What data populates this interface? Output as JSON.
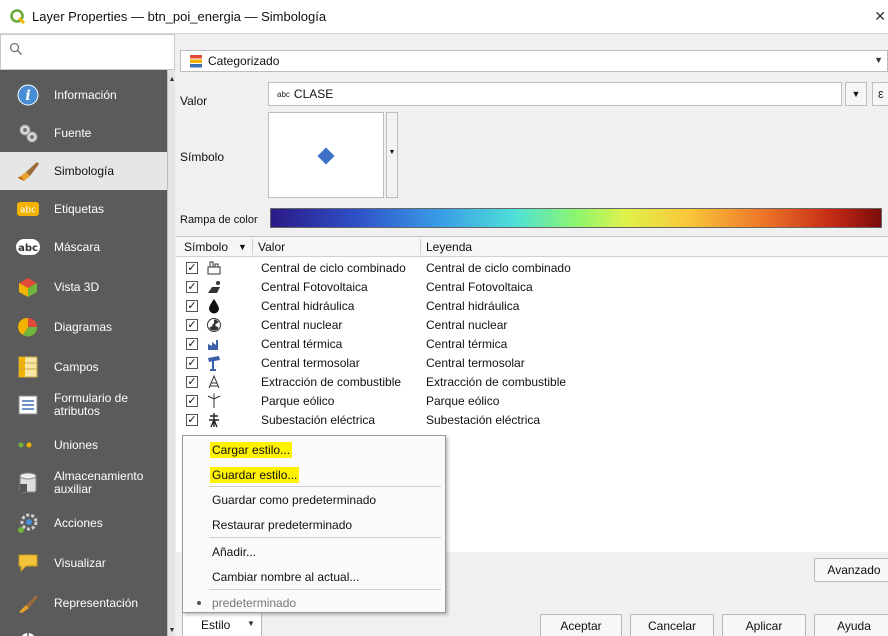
{
  "window": {
    "title": "Layer Properties — btn_poi_energia — Simbología"
  },
  "search": {
    "placeholder": ""
  },
  "sidebar": {
    "items": [
      {
        "label": "Información",
        "label2": "",
        "icon": "info-icon",
        "active": false
      },
      {
        "label": "Fuente",
        "label2": "",
        "icon": "source-icon",
        "active": false
      },
      {
        "label": "Simbología",
        "label2": "",
        "icon": "symbology-icon",
        "active": true
      },
      {
        "label": "Etiquetas",
        "label2": "",
        "icon": "labels-icon",
        "active": false
      },
      {
        "label": "Máscara",
        "label2": "",
        "icon": "mask-icon",
        "active": false
      },
      {
        "label": "Vista 3D",
        "label2": "",
        "icon": "3d-view-icon",
        "active": false
      },
      {
        "label": "Diagramas",
        "label2": "",
        "icon": "diagrams-icon",
        "active": false
      },
      {
        "label": "Campos",
        "label2": "",
        "icon": "fields-icon",
        "active": false
      },
      {
        "label": "Formulario de",
        "label2": "atributos",
        "icon": "attributes-form-icon",
        "active": false
      },
      {
        "label": "Uniones",
        "label2": "",
        "icon": "joins-icon",
        "active": false
      },
      {
        "label": "Almacenamiento",
        "label2": "auxiliar",
        "icon": "auxiliary-storage-icon",
        "active": false
      },
      {
        "label": "Acciones",
        "label2": "",
        "icon": "actions-icon",
        "active": false
      },
      {
        "label": "Visualizar",
        "label2": "",
        "icon": "display-icon",
        "active": false
      },
      {
        "label": "Representación",
        "label2": "",
        "icon": "rendering-icon",
        "active": false
      }
    ]
  },
  "renderer": {
    "value": "Categorizado"
  },
  "form": {
    "valor_label": "Valor",
    "valor_type": "abc",
    "valor_value": "CLASE",
    "simbolo_label": "Símbolo",
    "rampa_label": "Rampa de color",
    "symbol_color": "#3d71c7"
  },
  "table": {
    "headers": {
      "symbol": "Símbolo",
      "value": "Valor",
      "legend": "Leyenda"
    },
    "rows": [
      {
        "checked": "✓",
        "icon": "combined-cycle-icon",
        "value": "Central de ciclo combinado",
        "legend": "Central de ciclo combinado"
      },
      {
        "checked": "✓",
        "icon": "photovoltaic-icon",
        "value": "Central Fotovoltaica",
        "legend": "Central Fotovoltaica"
      },
      {
        "checked": "✓",
        "icon": "hydraulic-drop-icon",
        "value": "Central hidráulica",
        "legend": "Central hidráulica"
      },
      {
        "checked": "✓",
        "icon": "nuclear-icon",
        "value": "Central nuclear",
        "legend": "Central nuclear"
      },
      {
        "checked": "✓",
        "icon": "thermal-plant-icon",
        "value": "Central térmica",
        "legend": "Central térmica"
      },
      {
        "checked": "✓",
        "icon": "solar-thermal-icon",
        "value": "Central termosolar",
        "legend": "Central termosolar"
      },
      {
        "checked": "✓",
        "icon": "fuel-extraction-icon",
        "value": "Extracción de combustible",
        "legend": "Extracción de combustible"
      },
      {
        "checked": "✓",
        "icon": "wind-turbine-icon",
        "value": "Parque eólico",
        "legend": "Parque eólico"
      },
      {
        "checked": "✓",
        "icon": "substation-pylon-icon",
        "value": "Subestación eléctrica",
        "legend": "Subestación eléctrica"
      }
    ]
  },
  "style_menu": {
    "items": [
      {
        "label": "Cargar estilo...",
        "highlighted": true
      },
      {
        "label": "Guardar estilo...",
        "highlighted": true
      },
      {
        "label": "Guardar como predeterminado",
        "highlighted": false
      },
      {
        "label": "Restaurar predeterminado",
        "highlighted": false
      },
      {
        "label": "Añadir...",
        "highlighted": false
      },
      {
        "label": "Cambiar nombre al actual...",
        "highlighted": false
      },
      {
        "label": "predeterminado",
        "highlighted": false
      }
    ]
  },
  "buttons": {
    "avanzado": "Avanzado",
    "estilo": "Estilo",
    "aceptar": "Aceptar",
    "cancelar": "Cancelar",
    "aplicar": "Aplicar",
    "ayuda": "Ayuda"
  },
  "colors": {
    "highlight": "#fff200",
    "sidebar_bg": "#5b5b5b",
    "sidebar_active": "#e6e6e6"
  }
}
